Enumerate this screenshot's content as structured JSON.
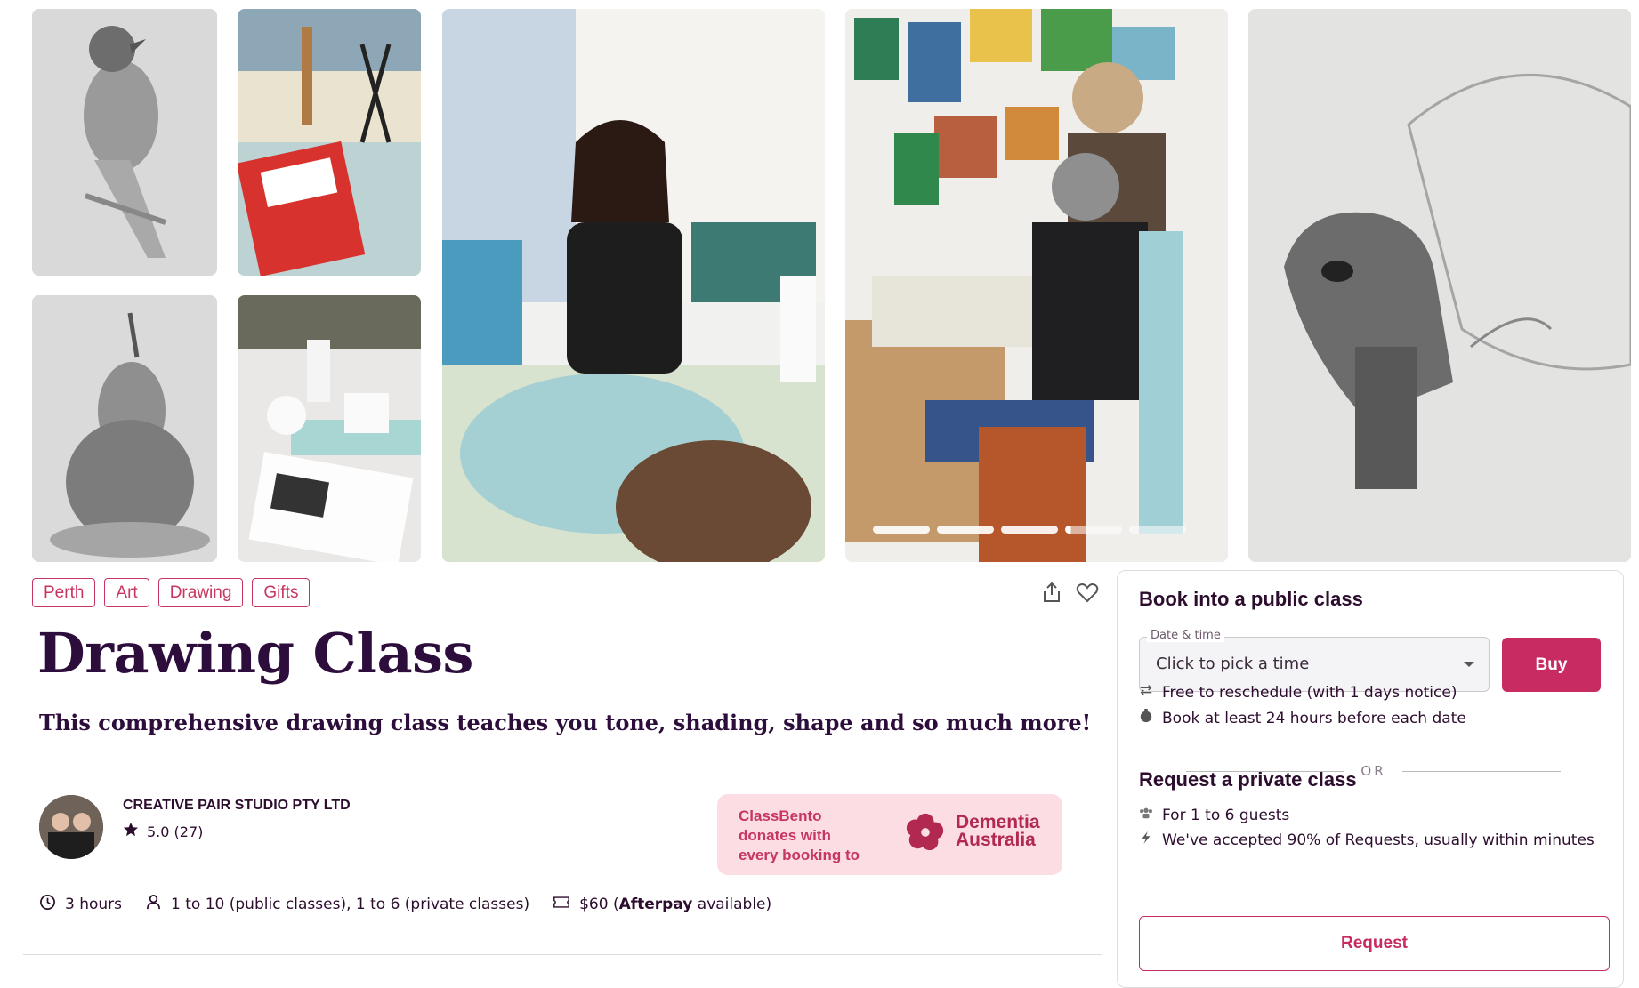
{
  "tags": [
    "Perth",
    "Art",
    "Drawing",
    "Gifts"
  ],
  "title": "Drawing Class",
  "subtitle": "This comprehensive drawing class teaches you tone, shading, shape and so much more!",
  "host": {
    "name": "CREATIVE PAIR STUDIO PTY LTD",
    "rating": "5.0 (27)"
  },
  "donation": {
    "text_line1": "ClassBento",
    "text_line2": "donates with",
    "text_line3": "every booking to",
    "org_line1": "Dementia",
    "org_line2": "Australia"
  },
  "facts": {
    "duration": "3 hours",
    "capacity": "1 to 10 (public classes), 1 to 6 (private classes)",
    "price": "$60 (",
    "afterpay": "Afterpay",
    "available": " available)"
  },
  "booking": {
    "public_heading": "Book into a public class",
    "date_label": "Date & time",
    "date_placeholder": "Click to pick a time",
    "buy_label": "Buy",
    "reschedule": "Free to reschedule (with 1 days notice)",
    "notice": "Book at least 24 hours before each date",
    "or": "OR",
    "private_heading": "Request a private class",
    "guests": "For 1 to 6 guests",
    "accepted": "We've accepted 90% of Requests, usually within minutes",
    "request_label": "Request"
  },
  "carousel": {
    "slides": 5,
    "active": 3
  },
  "colors": {
    "accent": "#c72b62",
    "title": "#2d0d3b"
  }
}
